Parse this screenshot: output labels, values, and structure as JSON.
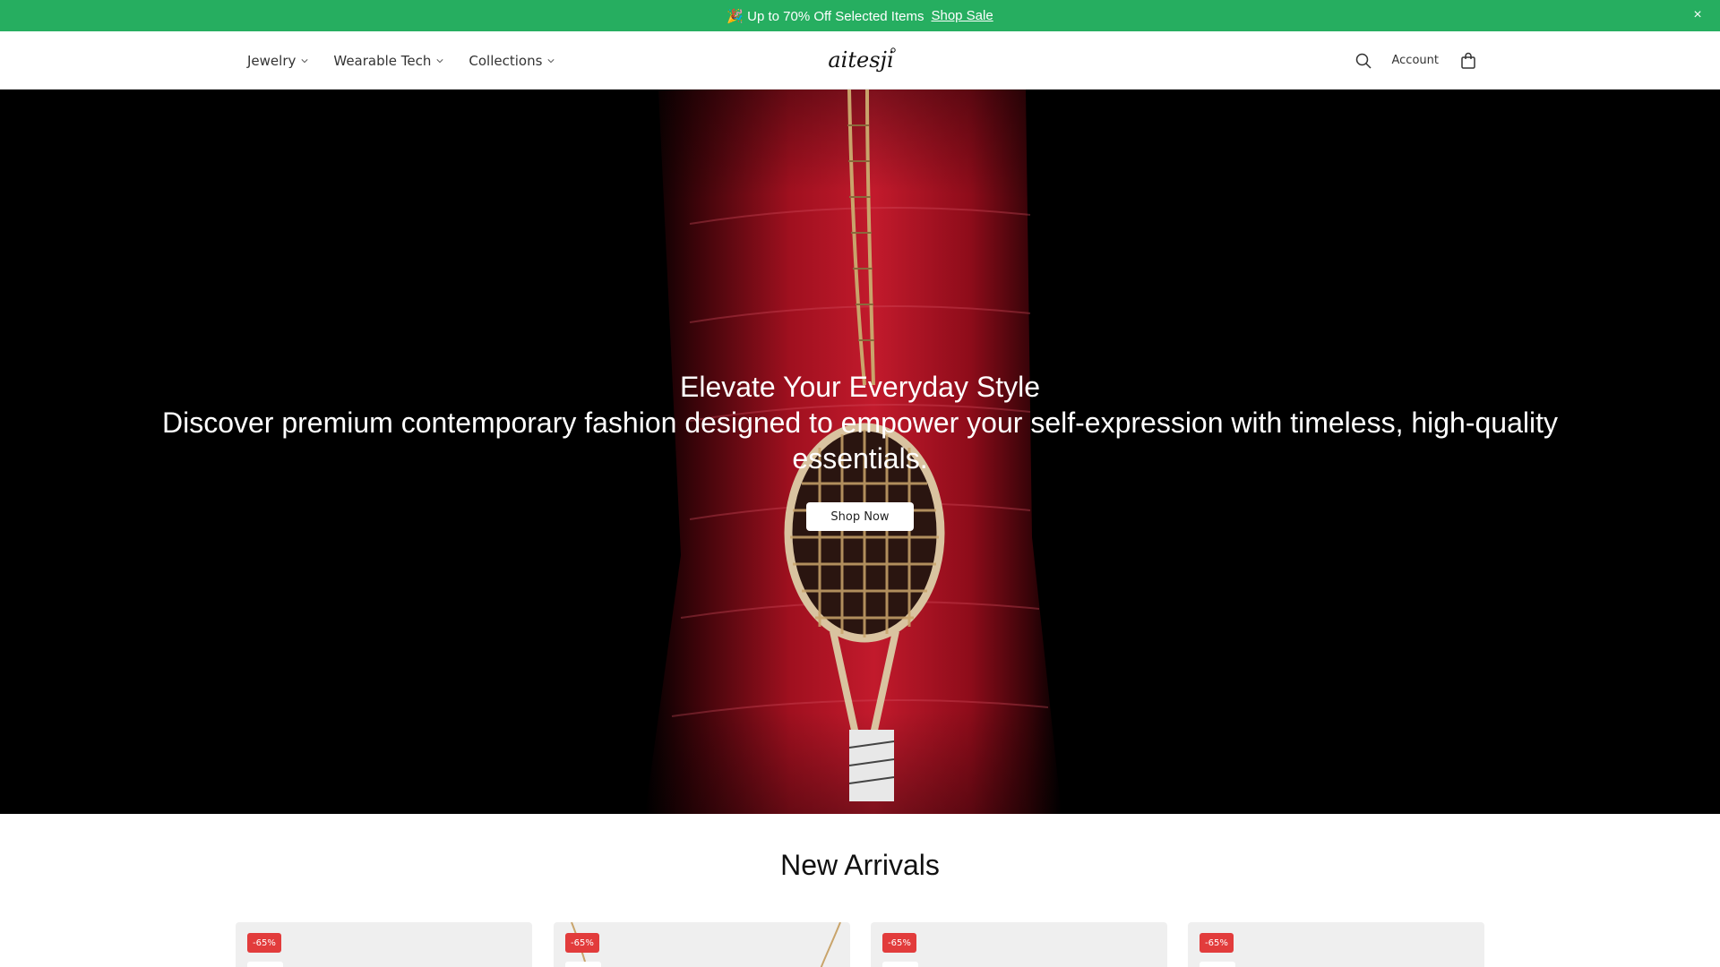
{
  "announcement": {
    "emoji": "🎉",
    "message": "Up to 70% Off Selected Items",
    "link_label": "Shop Sale",
    "close_label": "×"
  },
  "nav": {
    "items": [
      {
        "label": "Jewelry"
      },
      {
        "label": "Wearable Tech"
      },
      {
        "label": "Collections"
      }
    ]
  },
  "brand": {
    "logo_text": "aitesji"
  },
  "header": {
    "account_label": "Account"
  },
  "hero": {
    "title": "Elevate Your Everyday Style",
    "subtitle": "Discover premium contemporary fashion designed to empower your self-expression with timeless, high-quality essentials.",
    "cta_label": "Shop Now"
  },
  "new_arrivals": {
    "title": "New Arrivals",
    "products": [
      {
        "badge": "-65%"
      },
      {
        "badge": "-65%"
      },
      {
        "badge": "-65%"
      },
      {
        "badge": "-65%"
      }
    ]
  },
  "colors": {
    "announcement_bg": "#26ae60",
    "sale_badge": "#e23c3c",
    "hero_red": "#a0101f"
  }
}
